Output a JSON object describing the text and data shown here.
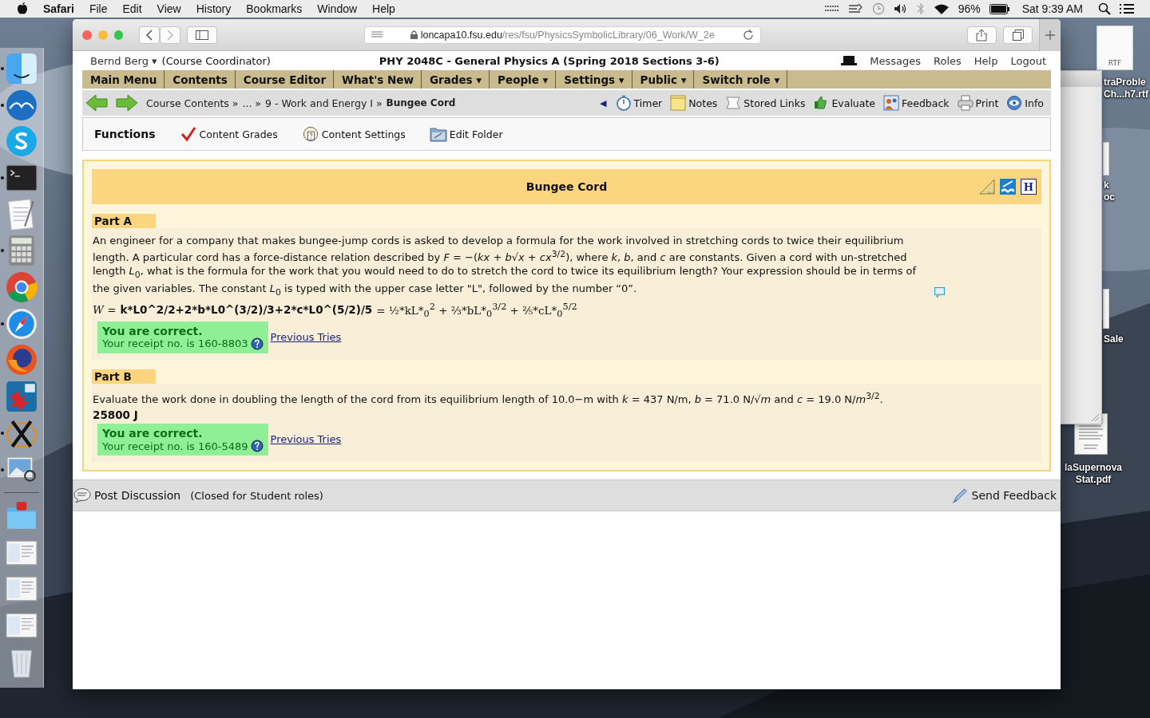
{
  "menu_bar": {
    "app": "Safari",
    "items": [
      "File",
      "Edit",
      "View",
      "History",
      "Bookmarks",
      "Window",
      "Help"
    ],
    "battery": "96%",
    "clock": "Sat 9:39 AM"
  },
  "dock": [
    {
      "kind": "finder",
      "running": true
    },
    {
      "kind": "openoffice",
      "running": true
    },
    {
      "kind": "skype",
      "running": false
    },
    {
      "kind": "terminal",
      "running": true
    },
    {
      "kind": "textedit",
      "running": false
    },
    {
      "kind": "calculator",
      "running": true
    },
    {
      "kind": "chrome",
      "running": false
    },
    {
      "kind": "safari",
      "running": true
    },
    {
      "kind": "firefox",
      "running": false
    },
    {
      "kind": "maple",
      "running": false
    },
    {
      "kind": "xquartz",
      "running": true
    },
    {
      "kind": "preview",
      "running": true
    },
    {
      "kind": "folder",
      "running": false
    },
    {
      "kind": "thumbnail",
      "running": false
    },
    {
      "kind": "thumbnail",
      "running": false
    },
    {
      "kind": "thumbnail",
      "running": false
    },
    {
      "kind": "trash",
      "running": false
    }
  ],
  "desktop_icons": [
    {
      "kind": "rtf",
      "badge": "RTF",
      "lines": [
        "traProble",
        "Ch...h7.rtf"
      ]
    },
    {
      "kind": "doc",
      "lines": [
        "k",
        "oc"
      ]
    },
    {
      "kind": "doc",
      "lines": [
        "Sale"
      ]
    },
    {
      "kind": "pdf",
      "lines": [
        "laSupernova",
        "Stat.pdf"
      ]
    }
  ],
  "browser": {
    "url_host": "loncapa10.fsu.edu",
    "url_path": "/res/fsu/PhysicsSymbolicLibrary/06_Work/W_2e"
  },
  "header": {
    "user": "Bernd Berg ▾",
    "role": "(Course Coordinator)",
    "course": "PHY 2048C - General Physics A (Spring 2018 Sections 3-6)",
    "links": [
      "Messages",
      "Roles",
      "Help",
      "Logout"
    ]
  },
  "main_nav": [
    {
      "label": "Main Menu"
    },
    {
      "label": "Contents"
    },
    {
      "label": "Course Editor"
    },
    {
      "label": "What's New"
    },
    {
      "label": "Grades ▾"
    },
    {
      "label": "People ▾"
    },
    {
      "label": "Settings ▾"
    },
    {
      "label": "Public ▾"
    },
    {
      "label": "Switch role ▾"
    }
  ],
  "breadcrumb": [
    {
      "label": "Course Contents »",
      "current": false
    },
    {
      "label": "... »",
      "current": false
    },
    {
      "label": "9 - Work and Energy I »",
      "current": false
    },
    {
      "label": "Bungee Cord",
      "current": true
    }
  ],
  "tools_toggle": "◀",
  "tools": [
    {
      "kind": "timer",
      "label": "Timer"
    },
    {
      "kind": "notes",
      "label": "Notes"
    },
    {
      "kind": "links",
      "label": "Stored Links"
    },
    {
      "kind": "evaluate",
      "label": "Evaluate"
    },
    {
      "kind": "feedback",
      "label": "Feedback"
    },
    {
      "kind": "print",
      "label": "Print"
    },
    {
      "kind": "info",
      "label": "Info"
    }
  ],
  "functions": {
    "title": "Functions",
    "items": [
      {
        "kind": "grades",
        "label": "Content Grades"
      },
      {
        "kind": "settings",
        "label": "Content Settings"
      },
      {
        "kind": "folder",
        "label": "Edit Folder"
      }
    ]
  },
  "problem": {
    "title": "Bungee Cord",
    "help_letter": "H",
    "parts": [
      {
        "label": "Part A",
        "text": "An engineer for a company that makes bungee-jump cords is asked to develop a formula for the work involved in stretching cords to twice their equilibrium length. A particular cord has a force-distance relation described by *F* = −(*kx* + *b*√*x* + *cx*$^{3/2}$), where *k*, *b*, and *c* are constants. Given a cord with un-stretched length *L*$_{0}$, what is the formula for the work that you would need to do to stretch the cord to twice its equilibrium length? Your expression should be in terms of the given variables. The constant *L*$_{0}$ is typed with the upper case letter \"L\", followed by the number “0”.",
        "has_note": true,
        "answer_prefix": "W =",
        "answer": "k*L0^2/2+2*b*L0^(3/2)/3+2*c*L0^(5/2)/5",
        "answer_rendered": "= ½*kL*$_{0}$$^{2}$ + ⅔*bL*$_{0}$$^{3/2}$ + ⅖*cL*$_{0}$$^{5/2}$",
        "status": "You are correct.",
        "receipt": "Your receipt no. is 160-8803",
        "tries": "Previous Tries"
      },
      {
        "label": "Part B",
        "text": "Evaluate the work done in doubling the length of the cord from its equilibrium length of 10.0−m with *k* = 437 N/m, *b* = 71.0 N/√*m* and *c* = 19.0 N/*m*$^{3/2}$.",
        "answer": "25800 J",
        "status": "You are correct.",
        "receipt": "Your receipt no. is 160-5489",
        "tries": "Previous Tries"
      }
    ]
  },
  "discussion": {
    "post": "Post Discussion",
    "note": "(Closed for Student roles)",
    "feedback": "Send Feedback"
  }
}
